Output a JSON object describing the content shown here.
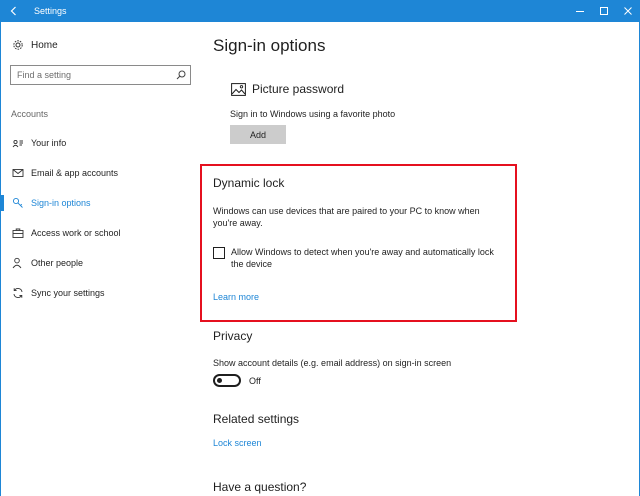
{
  "window": {
    "title": "Settings"
  },
  "sidebar": {
    "home_label": "Home",
    "search_placeholder": "Find a setting",
    "section_label": "Accounts",
    "items": [
      {
        "label": "Your info",
        "icon": "person-card-icon",
        "active": false
      },
      {
        "label": "Email & app accounts",
        "icon": "mail-icon",
        "active": false
      },
      {
        "label": "Sign-in options",
        "icon": "key-icon",
        "active": true
      },
      {
        "label": "Access work or school",
        "icon": "briefcase-icon",
        "active": false
      },
      {
        "label": "Other people",
        "icon": "person-add-icon",
        "active": false
      },
      {
        "label": "Sync your settings",
        "icon": "sync-icon",
        "active": false
      }
    ]
  },
  "main": {
    "page_title": "Sign-in options",
    "picture_password": {
      "title": "Picture password",
      "description": "Sign in to Windows using a favorite photo",
      "add_label": "Add"
    },
    "dynamic_lock": {
      "title": "Dynamic lock",
      "description": "Windows can use devices that are paired to your PC to know when you're away.",
      "checkbox_label": "Allow Windows to detect when you're away and automatically lock the device",
      "checked": false,
      "learn_more": "Learn more"
    },
    "privacy": {
      "title": "Privacy",
      "description": "Show account details (e.g. email address) on sign-in screen",
      "toggle_state": "Off"
    },
    "related_settings": {
      "title": "Related settings",
      "link": "Lock screen"
    },
    "question": {
      "title": "Have a question?"
    }
  },
  "colors": {
    "accent": "#1e86d6",
    "highlight": "#e5101f",
    "button_bg": "#cccccc"
  }
}
